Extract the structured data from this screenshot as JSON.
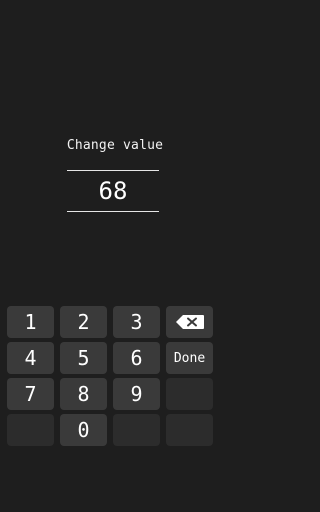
{
  "dialog": {
    "title": "Change value",
    "value": "68"
  },
  "keypad": {
    "keys": [
      "1",
      "2",
      "3",
      "4",
      "5",
      "6",
      "7",
      "8",
      "9",
      "0"
    ],
    "backspace_icon": "backspace-icon",
    "done_label": "Done"
  },
  "colors": {
    "background": "#1e1e1e",
    "key": "#3a3a3a",
    "key_empty": "#2c2c2c",
    "text": "#ffffff"
  }
}
